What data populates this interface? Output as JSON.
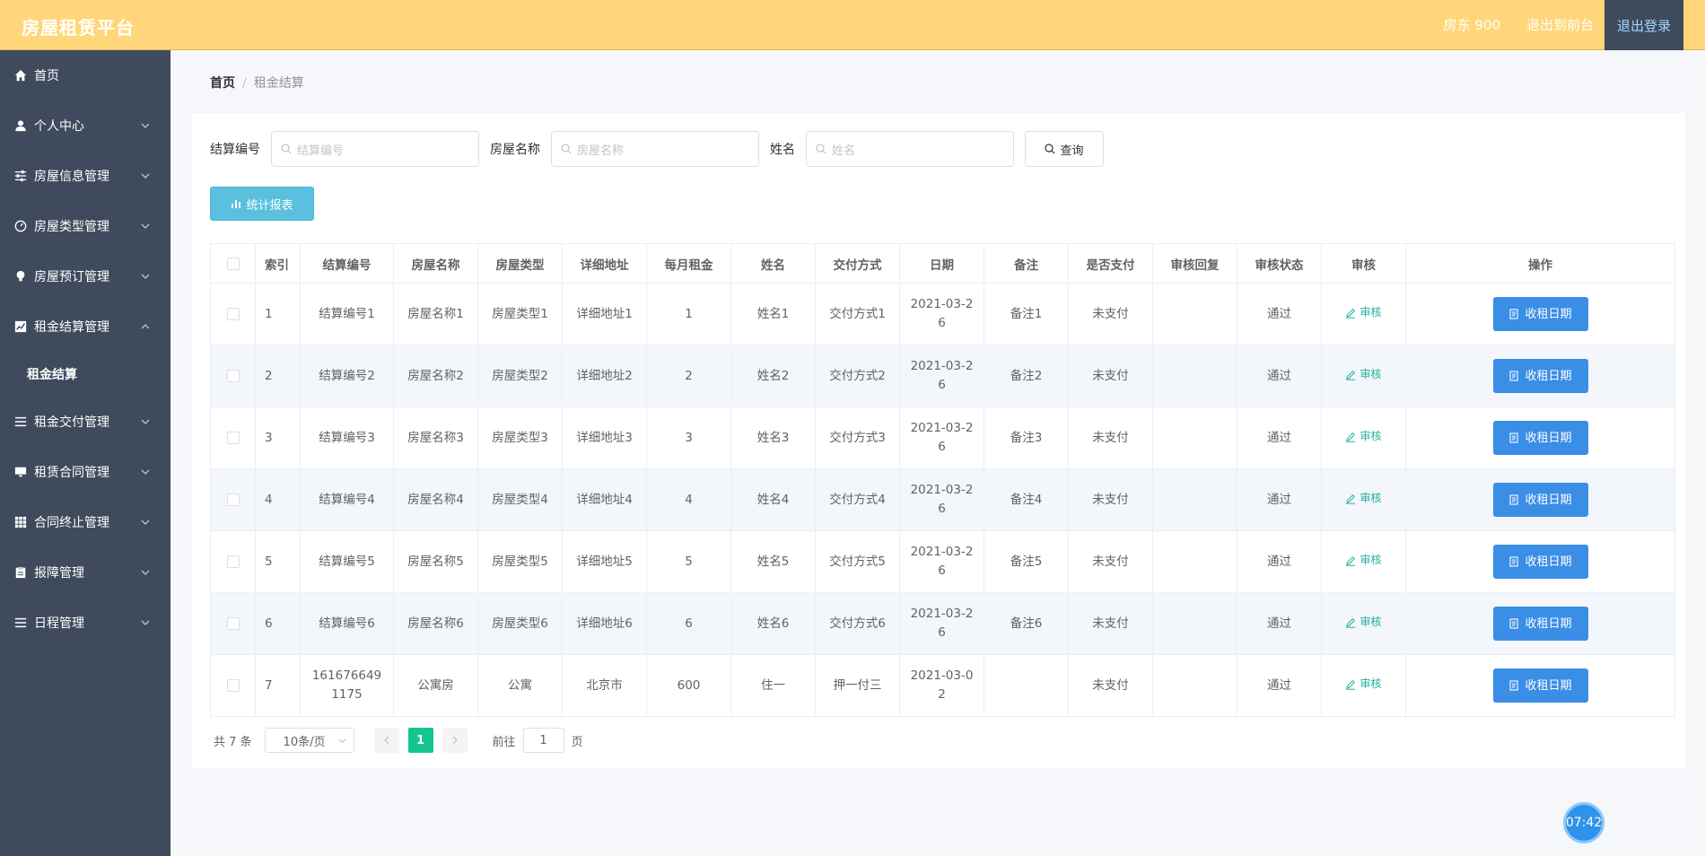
{
  "header": {
    "brand": "房屋租赁平台",
    "user": "房东 900",
    "front": "退出到前台",
    "logout": "退出登录"
  },
  "sidebar": {
    "items": [
      {
        "label": "首页",
        "icon": "home-icon"
      },
      {
        "label": "个人中心",
        "icon": "user-icon"
      },
      {
        "label": "房屋信息管理",
        "icon": "sliders-icon"
      },
      {
        "label": "房屋类型管理",
        "icon": "gauge-icon"
      },
      {
        "label": "房屋预订管理",
        "icon": "bulb-icon"
      },
      {
        "label": "租金结算管理",
        "icon": "chart-icon",
        "expanded": true
      },
      {
        "label": "租金交付管理",
        "icon": "list-icon"
      },
      {
        "label": "租赁合同管理",
        "icon": "monitor-icon"
      },
      {
        "label": "合同终止管理",
        "icon": "grid-icon"
      },
      {
        "label": "报障管理",
        "icon": "clipboard-icon"
      },
      {
        "label": "日程管理",
        "icon": "menu-icon"
      }
    ],
    "subitem": "租金结算"
  },
  "breadcrumb": {
    "home": "首页",
    "sep": "/",
    "current": "租金结算"
  },
  "search": {
    "f1_label": "结算编号",
    "f1_placeholder": "结算编号",
    "f2_label": "房屋名称",
    "f2_placeholder": "房屋名称",
    "f3_label": "姓名",
    "f3_placeholder": "姓名",
    "query": "查询"
  },
  "report_button": "统计报表",
  "table": {
    "headers": [
      "索引",
      "结算编号",
      "房屋名称",
      "房屋类型",
      "详细地址",
      "每月租金",
      "姓名",
      "交付方式",
      "日期",
      "备注",
      "是否支付",
      "审核回复",
      "审核状态",
      "审核",
      "操作"
    ],
    "audit_label": "审核",
    "action_label": "收租日期",
    "rows": [
      {
        "idx": "1",
        "code": "结算编号1",
        "name": "房屋名称1",
        "type": "房屋类型1",
        "addr": "详细地址1",
        "rent": "1",
        "person": "姓名1",
        "pay": "交付方式1",
        "date1": "2021-03-2",
        "date2": "6",
        "note": "备注1",
        "paid": "未支付",
        "reply": "",
        "status": "通过"
      },
      {
        "idx": "2",
        "code": "结算编号2",
        "name": "房屋名称2",
        "type": "房屋类型2",
        "addr": "详细地址2",
        "rent": "2",
        "person": "姓名2",
        "pay": "交付方式2",
        "date1": "2021-03-2",
        "date2": "6",
        "note": "备注2",
        "paid": "未支付",
        "reply": "",
        "status": "通过"
      },
      {
        "idx": "3",
        "code": "结算编号3",
        "name": "房屋名称3",
        "type": "房屋类型3",
        "addr": "详细地址3",
        "rent": "3",
        "person": "姓名3",
        "pay": "交付方式3",
        "date1": "2021-03-2",
        "date2": "6",
        "note": "备注3",
        "paid": "未支付",
        "reply": "",
        "status": "通过"
      },
      {
        "idx": "4",
        "code": "结算编号4",
        "name": "房屋名称4",
        "type": "房屋类型4",
        "addr": "详细地址4",
        "rent": "4",
        "person": "姓名4",
        "pay": "交付方式4",
        "date1": "2021-03-2",
        "date2": "6",
        "note": "备注4",
        "paid": "未支付",
        "reply": "",
        "status": "通过"
      },
      {
        "idx": "5",
        "code": "结算编号5",
        "name": "房屋名称5",
        "type": "房屋类型5",
        "addr": "详细地址5",
        "rent": "5",
        "person": "姓名5",
        "pay": "交付方式5",
        "date1": "2021-03-2",
        "date2": "6",
        "note": "备注5",
        "paid": "未支付",
        "reply": "",
        "status": "通过"
      },
      {
        "idx": "6",
        "code": "结算编号6",
        "name": "房屋名称6",
        "type": "房屋类型6",
        "addr": "详细地址6",
        "rent": "6",
        "person": "姓名6",
        "pay": "交付方式6",
        "date1": "2021-03-2",
        "date2": "6",
        "note": "备注6",
        "paid": "未支付",
        "reply": "",
        "status": "通过"
      },
      {
        "idx": "7",
        "code": "161676649",
        "code2": "1175",
        "name": "公寓房",
        "type": "公寓",
        "addr": "北京市",
        "rent": "600",
        "person": "住一",
        "pay": "押一付三",
        "date1": "2021-03-0",
        "date2": "2",
        "note": "",
        "paid": "未支付",
        "reply": "",
        "status": "通过"
      }
    ]
  },
  "pagination": {
    "total": "共 7 条",
    "page_size": "10条/页",
    "current": "1",
    "goto_prefix": "前往",
    "goto_value": "1",
    "goto_suffix": "页"
  },
  "timer": "07:42"
}
